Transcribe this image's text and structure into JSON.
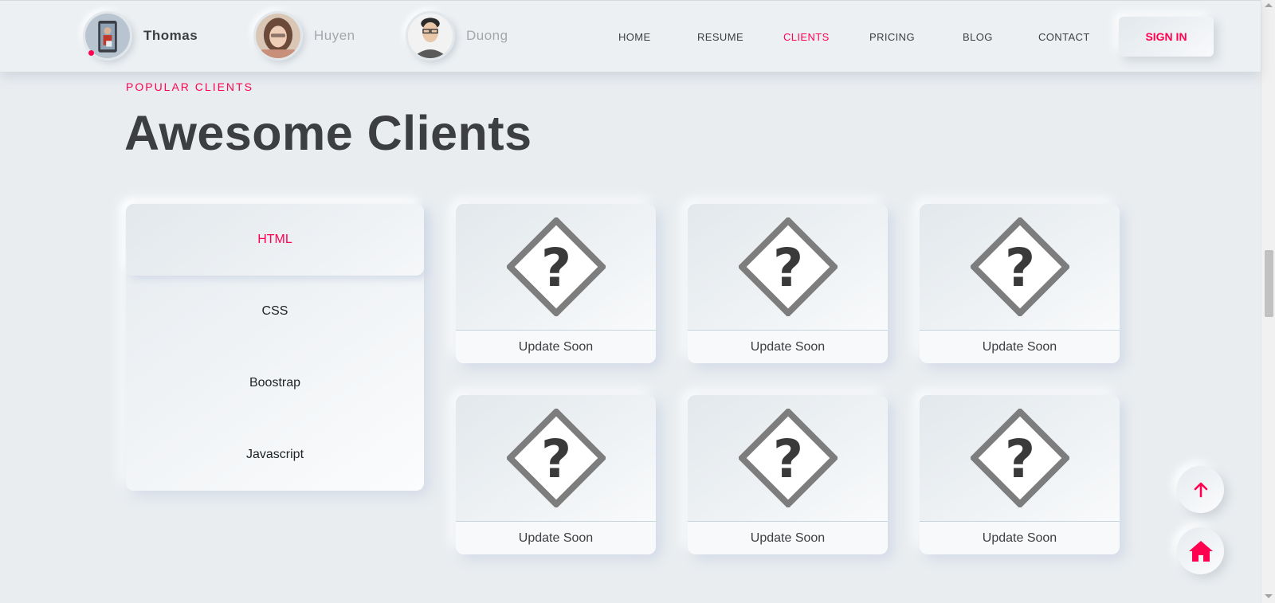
{
  "header": {
    "profiles": [
      {
        "name": "Thomas",
        "active": true
      },
      {
        "name": "Huyen",
        "active": false
      },
      {
        "name": "Duong",
        "active": false
      }
    ],
    "nav": [
      {
        "label": "HOME",
        "active": false
      },
      {
        "label": "RESUME",
        "active": false
      },
      {
        "label": "CLIENTS",
        "active": true
      },
      {
        "label": "PRICING",
        "active": false
      },
      {
        "label": "BLOG",
        "active": false
      },
      {
        "label": "CONTACT",
        "active": false
      }
    ],
    "signin_label": "SIGN IN"
  },
  "section": {
    "subtitle": "POPULAR CLIENTS",
    "title": "Awesome Clients"
  },
  "tabs": [
    {
      "label": "HTML",
      "active": true
    },
    {
      "label": "CSS",
      "active": false
    },
    {
      "label": "Boostrap",
      "active": false
    },
    {
      "label": "Javascript",
      "active": false
    }
  ],
  "cards": [
    {
      "label": "Update Soon",
      "icon": "missing-image-icon"
    },
    {
      "label": "Update Soon",
      "icon": "missing-image-icon"
    },
    {
      "label": "Update Soon",
      "icon": "missing-image-icon"
    },
    {
      "label": "Update Soon",
      "icon": "missing-image-icon"
    },
    {
      "label": "Update Soon",
      "icon": "missing-image-icon"
    },
    {
      "label": "Update Soon",
      "icon": "missing-image-icon"
    }
  ],
  "floating_buttons": [
    {
      "icon": "arrow-up-icon"
    },
    {
      "icon": "home-icon"
    }
  ],
  "colors": {
    "accent": "#ff014f",
    "background": "#e9edf0",
    "text": "#3c3e41"
  }
}
